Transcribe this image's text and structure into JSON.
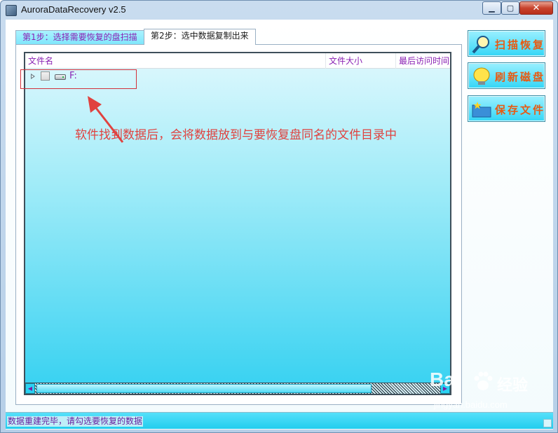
{
  "window": {
    "title": "AuroraDataRecovery v2.5",
    "minimize_glyph": "▁",
    "maximize_glyph": "▢",
    "close_glyph": "✕"
  },
  "tabs": [
    {
      "label": "第1步：选择需要恢复的盘扫描",
      "active": false
    },
    {
      "label": "第2步：选中数据复制出来",
      "active": true
    }
  ],
  "tree": {
    "columns": [
      "文件名",
      "文件大小",
      "最后访问时间"
    ],
    "rows": [
      {
        "label": "F:",
        "icon": "drive-icon",
        "checked": false,
        "expanded": false
      }
    ]
  },
  "annotation": {
    "text": "软件找到数据后，会将数据放到与要恢复盘同名的文件目录中",
    "color": "#e0423f"
  },
  "scrollbar": {
    "left_glyph": "◀",
    "right_glyph": "▶"
  },
  "buttons": {
    "scan": {
      "label": "扫描恢复",
      "icon": "magnifier-icon"
    },
    "refresh": {
      "label": "刷新磁盘",
      "icon": "lightbulb-icon"
    },
    "save": {
      "label": "保存文件",
      "icon": "folder-star-icon"
    }
  },
  "status": {
    "text": "数据重建完毕，请勾选要恢复的数据"
  },
  "watermark": {
    "logo": "Bai",
    "logo_suffix": "经验",
    "url": "jingyan.baidu.com"
  },
  "colors": {
    "accent_purple": "#8a21b3",
    "button_text": "#e85a12",
    "cyan": "#34d6f6"
  }
}
